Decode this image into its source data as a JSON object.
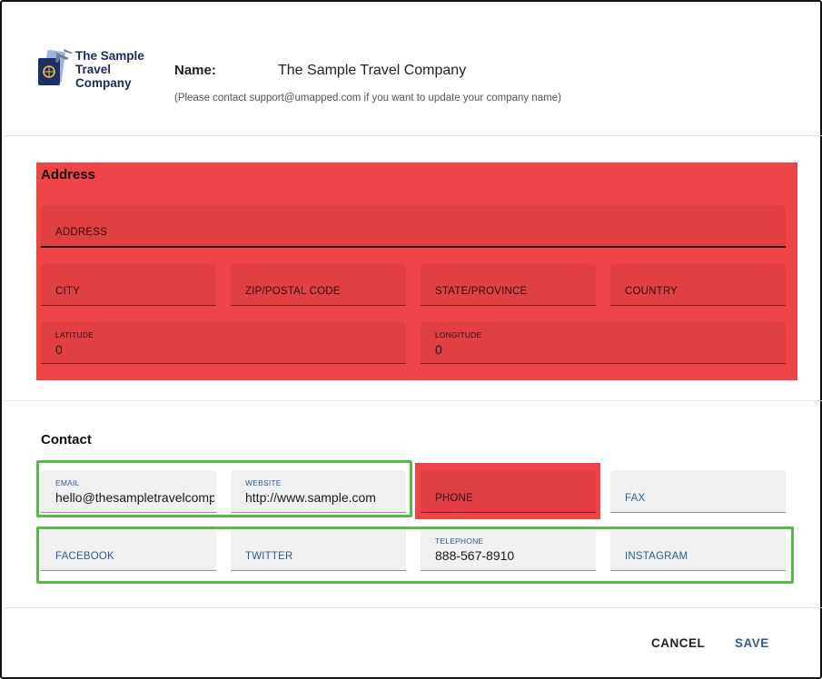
{
  "company": {
    "logo_lines": [
      "The Sample",
      "Travel",
      "Company"
    ],
    "name_label": "Name:",
    "name_value": "The Sample Travel Company",
    "name_note": "(Please contact support@umapped.com if you want to update your company name)"
  },
  "address": {
    "title": "Address",
    "address_label": "ADDRESS",
    "city_label": "CITY",
    "zip_label": "ZIP/POSTAL CODE",
    "state_label": "STATE/PROVINCE",
    "country_label": "COUNTRY",
    "latitude_label": "LATITUDE",
    "latitude_value": "0",
    "longitude_label": "LONGITUDE",
    "longitude_value": "0"
  },
  "contact": {
    "title": "Contact",
    "email_label": "EMAIL",
    "email_value": "hello@thesampletravelcompany.com",
    "website_label": "WEBSITE",
    "website_value": "http://www.sample.com",
    "phone_label": "PHONE",
    "fax_label": "FAX",
    "facebook_label": "FACEBOOK",
    "twitter_label": "TWITTER",
    "telephone_label": "TELEPHONE",
    "telephone_value": "888-567-8910",
    "instagram_label": "INSTAGRAM"
  },
  "actions": {
    "cancel_label": "CANCEL",
    "save_label": "SAVE"
  },
  "colors": {
    "highlight_red": "#ef4448",
    "highlight_green": "#5ab84a",
    "accent_blue": "#2f5d93"
  },
  "icons": {
    "logo": "passport-airplane-logo"
  }
}
